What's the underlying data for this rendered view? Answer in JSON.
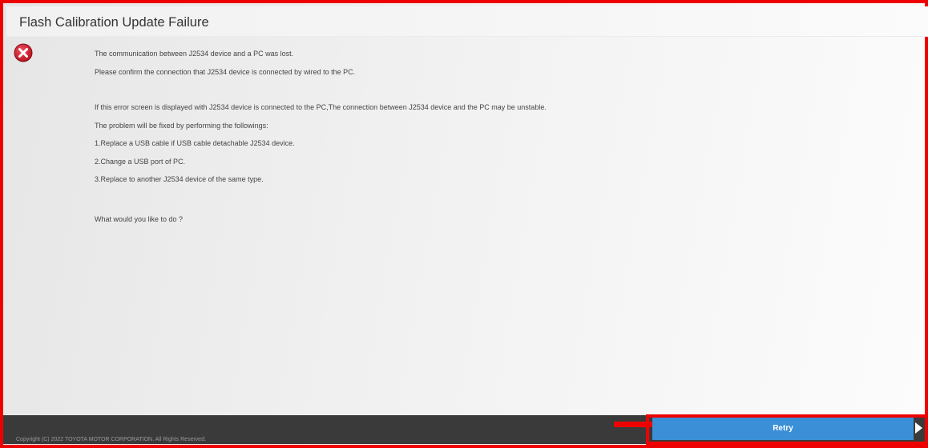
{
  "header": {
    "title": "Flash Calibration Update Failure"
  },
  "icons": {
    "status": "error-circle-x-icon",
    "annotation_arrow": "red-right-arrow-icon",
    "next": "play-right-icon"
  },
  "message": {
    "lines": [
      "The communication between J2534 device and a PC was lost.",
      "Please confirm the connection that J2534 device is connected by wired to the PC.",
      "If this error screen is displayed with J2534 device is connected to the PC,The connection between J2534 device and the PC may be unstable.",
      "The problem will be fixed by performing the followings:",
      "1.Replace a USB cable if USB cable detachable J2534 device.",
      "2.Change a USB port of PC.",
      "3.Replace to another J2534 device of the same type."
    ],
    "question": "What would you like to do ?"
  },
  "footer": {
    "retry_label": "Retry",
    "copyright": "Copyright (C) 2022 TOYOTA MOTOR CORPORATION. All Rights Reserved."
  },
  "colors": {
    "annotation_red": "#ee0000",
    "retry_blue": "#3a8fd6",
    "footer_dark": "#3a3a3a",
    "error_red": "#d11a2a"
  }
}
